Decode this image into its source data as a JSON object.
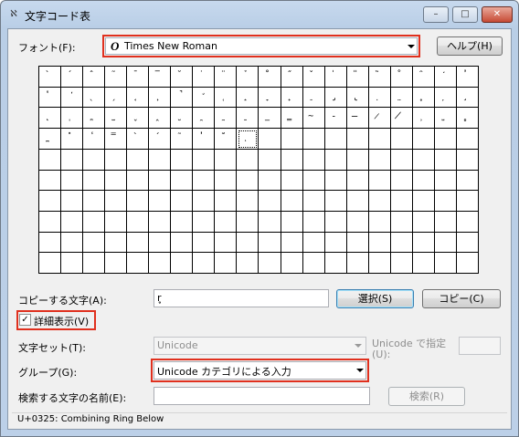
{
  "window": {
    "title": "文字コード表",
    "app_icon_symbol": "ℵ",
    "controls": {
      "minimize": "–",
      "maximize": "□",
      "close": "✕"
    }
  },
  "font": {
    "label": "フォント(F):",
    "selected": "Times New Roman",
    "type_glyph": "O",
    "help_button": "ヘルプ(H)"
  },
  "char_grid": {
    "selected_index": 69,
    "cells": [
      "̀",
      "́",
      "̂",
      "̃",
      "̄",
      "̅",
      "̆",
      "̇",
      "̈",
      "̉",
      "̊",
      "̋",
      "̌",
      "̍",
      "̎",
      "̏",
      "̐",
      "̑",
      "̒",
      "̓",
      "̔",
      "̕",
      "̖",
      "̗",
      "̘",
      "̙",
      "̚",
      "̛",
      "̜",
      "̝",
      "̞",
      "̟",
      "̠",
      "̡",
      "̢",
      "̣",
      "̤",
      "̥",
      "̦",
      "̧",
      "̨",
      "̩",
      "̪",
      "̫",
      "̬",
      "̭",
      "̮",
      "̯",
      "̰",
      "̱",
      "̲",
      "̳",
      "̴",
      "̵",
      "̶",
      "̷",
      "̸",
      "̹",
      "̺",
      "̻",
      "̼",
      "̽",
      "̾",
      "̿",
      "̀",
      "́",
      "͂",
      "̓",
      "̈́",
      "ͅ",
      "",
      "",
      "",
      "",
      "",
      "",
      "",
      "",
      "",
      "",
      "",
      "",
      "",
      "",
      "",
      "",
      "",
      "",
      "",
      "",
      "",
      "",
      "",
      "",
      "",
      "",
      "",
      "",
      "",
      "",
      "",
      "",
      "",
      "",
      "",
      "",
      "",
      "",
      "",
      "",
      "",
      "",
      "",
      "",
      "",
      "",
      "",
      "",
      "",
      "",
      "",
      "",
      "",
      "",
      "",
      "",
      "",
      "",
      "",
      "",
      "",
      "",
      "",
      "",
      "",
      "",
      "",
      "",
      "",
      "",
      "",
      "",
      "",
      "",
      "",
      "",
      "",
      "",
      "",
      "",
      "",
      "",
      "",
      "",
      "",
      "",
      "",
      "",
      "",
      "",
      "",
      "",
      "",
      "",
      "",
      "",
      "",
      "",
      "",
      "",
      "",
      "",
      "",
      "",
      "",
      "",
      "",
      "",
      "",
      "",
      "",
      "",
      "",
      "",
      "",
      "",
      "",
      "",
      "",
      "",
      "",
      "",
      "",
      "",
      "",
      "",
      "",
      "",
      "",
      ""
    ]
  },
  "copy": {
    "label": "コピーする文字(A):",
    "value": "r̥",
    "select_button": "選択(S)",
    "copy_button": "コピー(C)"
  },
  "advanced": {
    "label": "詳細表示(V)",
    "checked": true,
    "check_mark": "✓"
  },
  "charset": {
    "label": "文字セット(T):",
    "value": "Unicode",
    "goto_label_1": "Unicode で指定",
    "goto_label_2": "(U):",
    "goto_value": ""
  },
  "group": {
    "label": "グループ(G):",
    "value": "Unicode カテゴリによる入力"
  },
  "search": {
    "label": "検索する文字の名前(E):",
    "value": "",
    "search_button": "検索(R)"
  },
  "status": {
    "text": "U+0325: Combining Ring Below"
  },
  "colors": {
    "highlight_box": "#e0301e",
    "titlebar": "#bcd0e8"
  }
}
